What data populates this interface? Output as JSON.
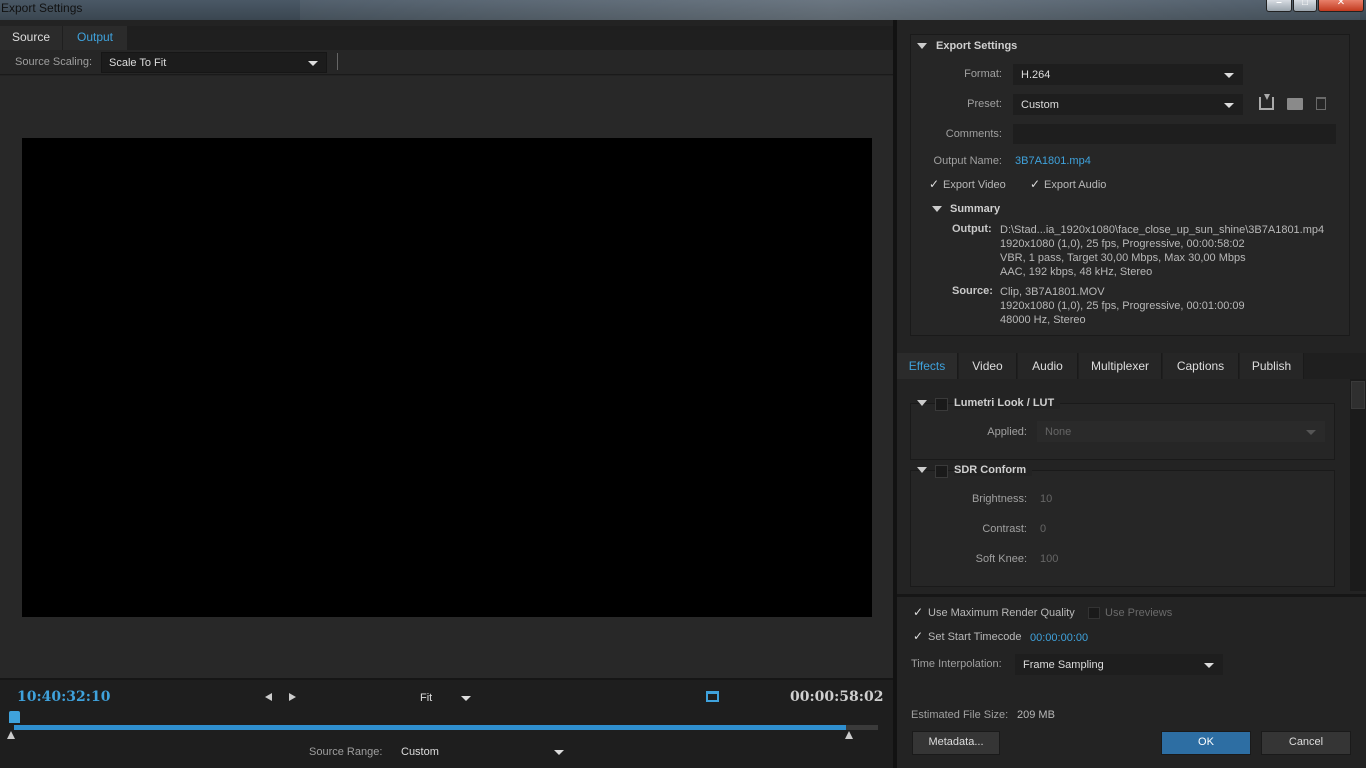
{
  "window": {
    "title": "Export Settings"
  },
  "left": {
    "tabs": [
      {
        "label": "Source"
      },
      {
        "label": "Output"
      }
    ],
    "source_scaling": {
      "label": "Source Scaling:",
      "value": "Scale To Fit"
    },
    "timeline": {
      "current_timecode": "10:40:32:10",
      "duration_timecode": "00:00:58:02",
      "zoom": "Fit",
      "source_range_label": "Source Range:",
      "source_range_value": "Custom"
    }
  },
  "export_settings": {
    "heading": "Export Settings",
    "format_label": "Format:",
    "format_value": "H.264",
    "preset_label": "Preset:",
    "preset_value": "Custom",
    "comments_label": "Comments:",
    "comments_value": "",
    "output_name_label": "Output Name:",
    "output_name_value": "3B7A1801.mp4",
    "export_video_label": "Export Video",
    "export_audio_label": "Export Audio",
    "summary": {
      "heading": "Summary",
      "output_label": "Output:",
      "output_lines": [
        "D:\\Stad...ia_1920x1080\\face_close_up_sun_shine\\3B7A1801.mp4",
        "1920x1080 (1,0), 25 fps, Progressive, 00:00:58:02",
        "VBR, 1 pass, Target 30,00 Mbps, Max 30,00 Mbps",
        "AAC, 192 kbps, 48 kHz, Stereo"
      ],
      "source_label": "Source:",
      "source_lines": [
        "Clip, 3B7A1801.MOV",
        "1920x1080 (1,0), 25 fps, Progressive, 00:01:00:09",
        "48000 Hz, Stereo"
      ]
    }
  },
  "right_tabs": [
    {
      "label": "Effects"
    },
    {
      "label": "Video"
    },
    {
      "label": "Audio"
    },
    {
      "label": "Multiplexer"
    },
    {
      "label": "Captions"
    },
    {
      "label": "Publish"
    }
  ],
  "effects": {
    "lumetri": {
      "heading": "Lumetri Look / LUT",
      "applied_label": "Applied:",
      "applied_value": "None"
    },
    "sdr": {
      "heading": "SDR Conform",
      "brightness_label": "Brightness:",
      "brightness_value": "10",
      "contrast_label": "Contrast:",
      "contrast_value": "0",
      "softknee_label": "Soft Knee:",
      "softknee_value": "100"
    }
  },
  "bottom": {
    "max_render_quality": "Use Maximum Render Quality",
    "use_previews": "Use Previews",
    "set_start_timecode": "Set Start Timecode",
    "start_timecode_value": "00:00:00:00",
    "time_interpolation_label": "Time Interpolation:",
    "time_interpolation_value": "Frame Sampling",
    "estimated_size_label": "Estimated File Size:",
    "estimated_size_value": "209 MB",
    "metadata_button": "Metadata...",
    "ok_button": "OK",
    "cancel_button": "Cancel"
  },
  "colors": {
    "accent": "#3fa2dc",
    "timeline_bar": "#2f8fcf",
    "ok_button": "#2d6ea3"
  }
}
